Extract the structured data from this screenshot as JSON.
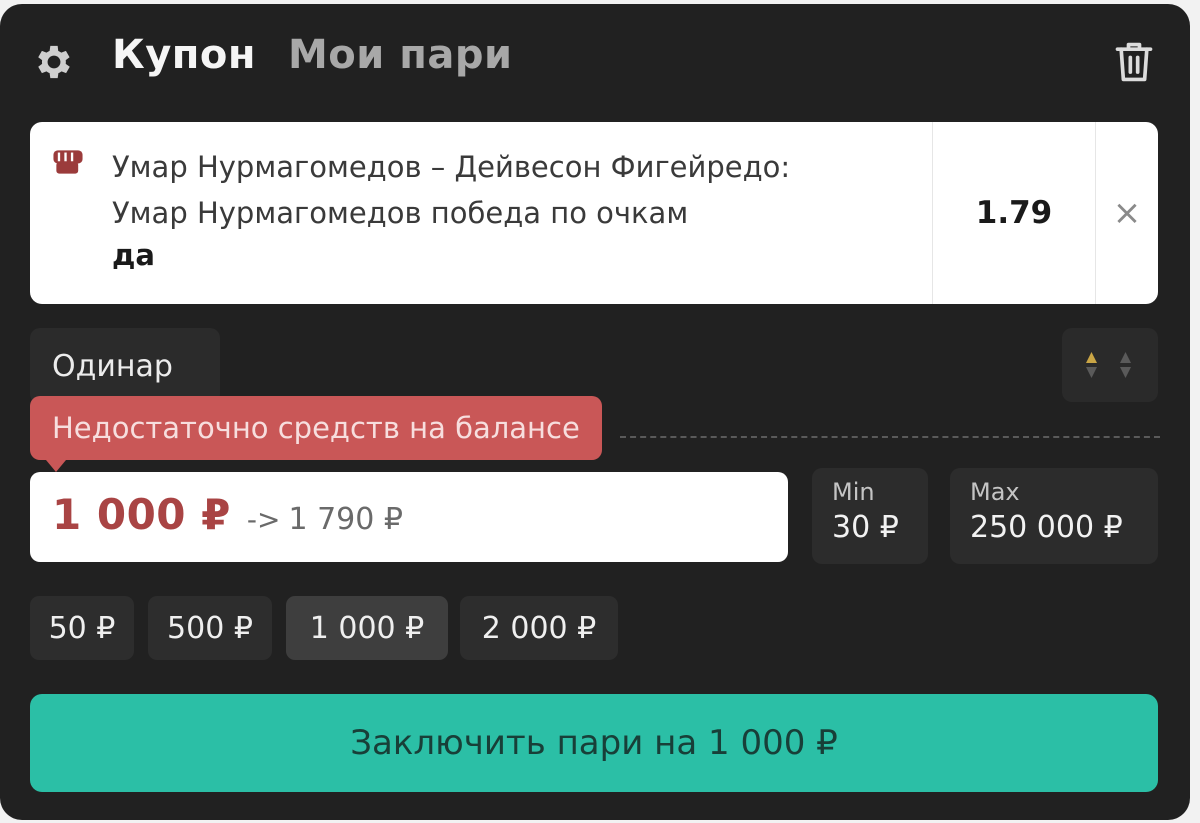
{
  "header": {
    "tabs": [
      {
        "label": "Купон"
      },
      {
        "label": "Мои пари"
      }
    ]
  },
  "icons": {
    "settings": "gear-icon",
    "clear": "trash-icon",
    "sport": "fist-icon",
    "remove": "close-icon",
    "sort": "sort-arrows-icon"
  },
  "bet": {
    "event_line1": "Умар Нурмагомедов – Дейвесон Фигейредо:",
    "event_line2": "Умар Нурмагомедов победа по очкам",
    "outcome": "да",
    "odds": "1.79",
    "remove_symbol": "×"
  },
  "bet_type": "Одинар",
  "error": "Недостаточно средств на балансе",
  "stake": {
    "amount": "1 000 ₽",
    "arrow": "->",
    "potential_win": "1 790 ₽"
  },
  "limits": {
    "min_label": "Min",
    "min_value": "30 ₽",
    "max_label": "Max",
    "max_value": "250 000 ₽"
  },
  "quick_amounts": [
    "50 ₽",
    "500 ₽",
    "1 000 ₽",
    "2 000 ₽"
  ],
  "submit_label": "Заключить пари на 1 000 ₽",
  "colors": {
    "panel": "#212121",
    "accent": "#2bbfa6",
    "error": "#c95757",
    "stake_text": "#a94444",
    "sort_active": "#c9a545"
  }
}
